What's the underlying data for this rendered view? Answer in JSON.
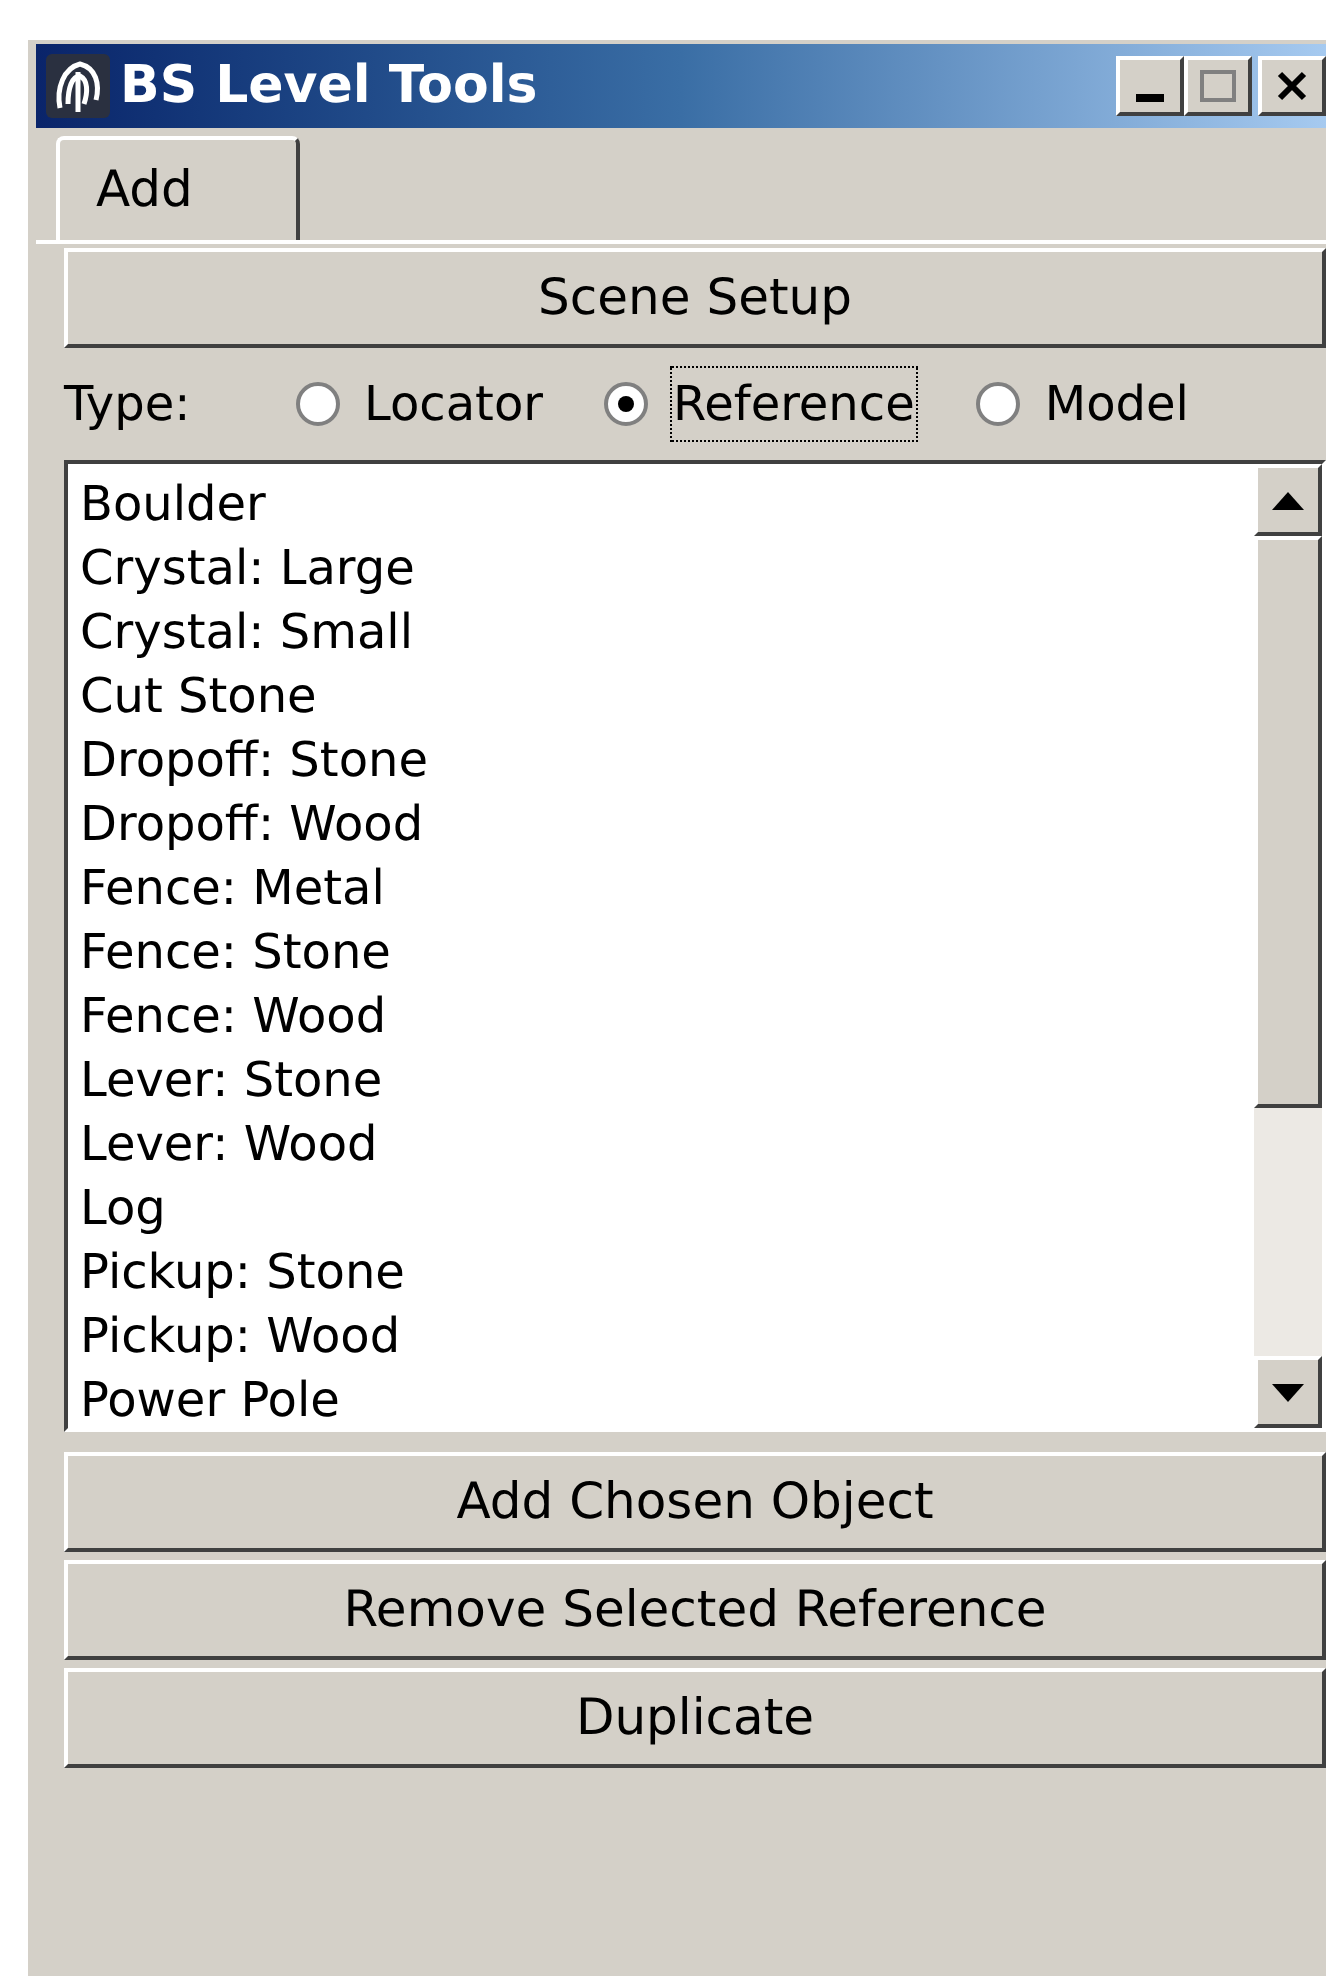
{
  "window": {
    "title": "BS Level Tools"
  },
  "tabs": [
    {
      "label": "Add",
      "selected": true
    }
  ],
  "scene_setup_button": "Scene Setup",
  "type_group": {
    "label": "Type:",
    "options": [
      {
        "label": "Locator",
        "selected": false
      },
      {
        "label": "Reference",
        "selected": true
      },
      {
        "label": "Model",
        "selected": false
      }
    ]
  },
  "object_list": {
    "items": [
      "Boulder",
      "Crystal: Large",
      "Crystal: Small",
      "Cut Stone",
      "Dropoff: Stone",
      "Dropoff: Wood",
      "Fence: Metal",
      "Fence: Stone",
      "Fence: Wood",
      "Lever: Stone",
      "Lever: Wood",
      "Log",
      "Pickup: Stone",
      "Pickup: Wood",
      "Power Pole"
    ]
  },
  "buttons": [
    "Add Chosen Object",
    "Remove Selected Reference",
    "Duplicate"
  ]
}
